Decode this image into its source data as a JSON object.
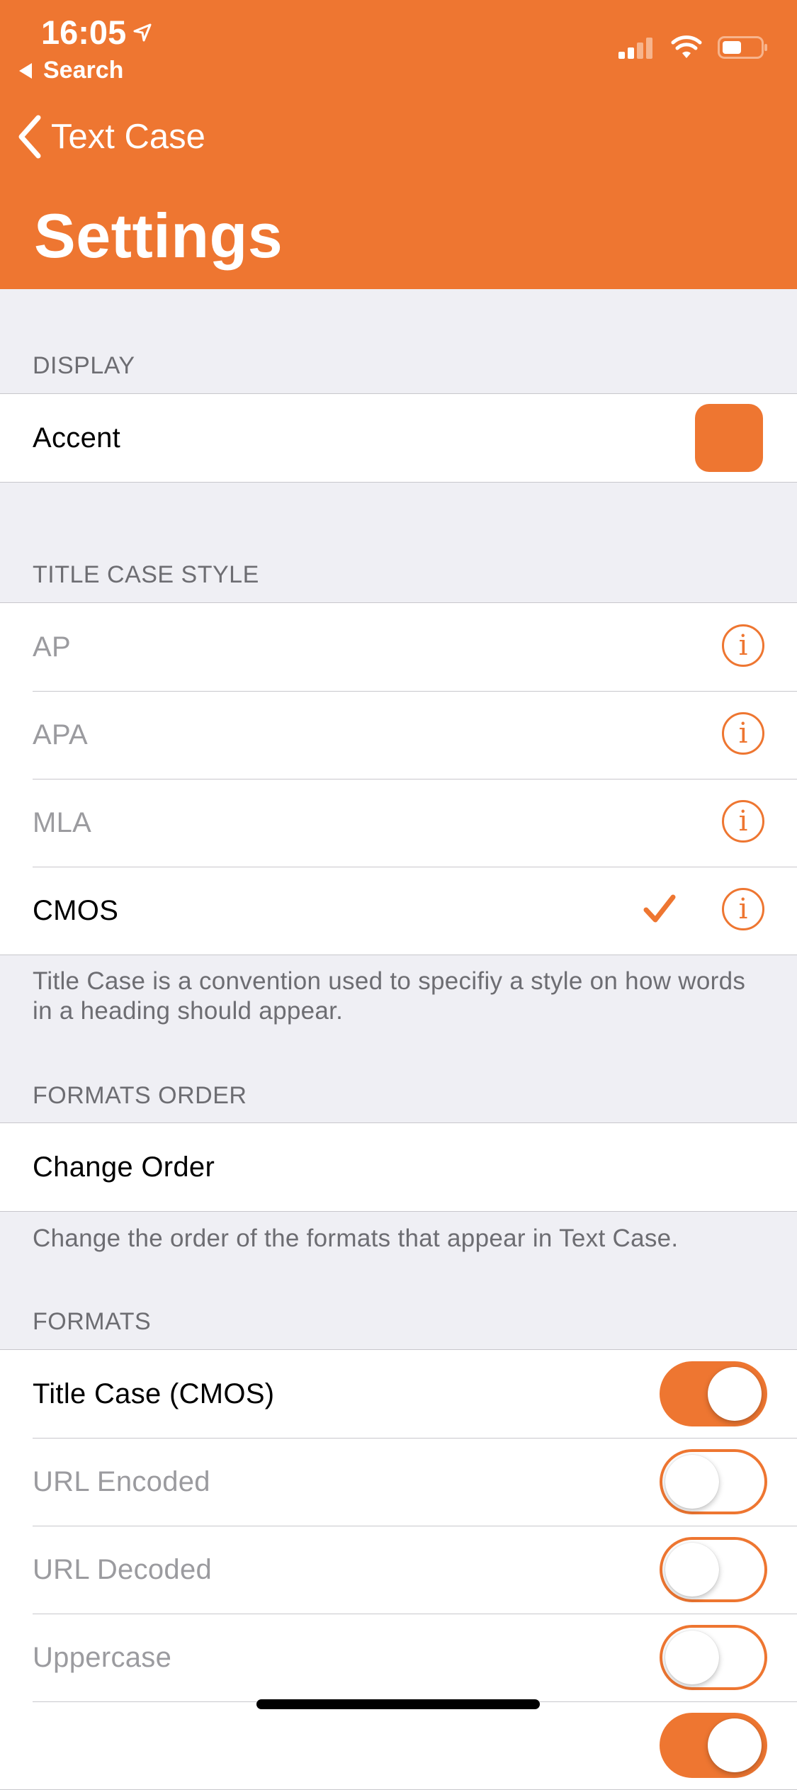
{
  "status_bar": {
    "time": "16:05",
    "back_app": "Search"
  },
  "nav": {
    "back_label": "Text Case",
    "title": "Settings"
  },
  "colors": {
    "accent": "#ee7631"
  },
  "display": {
    "header": "DISPLAY",
    "accent_label": "Accent"
  },
  "title_case_style": {
    "header": "TITLE CASE STYLE",
    "options": [
      {
        "label": "AP",
        "selected": false,
        "info_icon": "info-circle-icon"
      },
      {
        "label": "APA",
        "selected": false,
        "info_icon": "info-circle-icon"
      },
      {
        "label": "MLA",
        "selected": false,
        "info_icon": "info-circle-icon"
      },
      {
        "label": "CMOS",
        "selected": true,
        "info_icon": "info-circle-icon"
      }
    ],
    "footer": "Title Case is a convention used to specifiy a style on how words in a heading should appear."
  },
  "formats_order": {
    "header": "FORMATS ORDER",
    "change_label": "Change Order",
    "footer": "Change the order of the formats that appear in Text Case."
  },
  "formats": {
    "header": "FORMATS",
    "items": [
      {
        "label": "Title Case (CMOS)",
        "enabled": true
      },
      {
        "label": "URL Encoded",
        "enabled": false
      },
      {
        "label": "URL Decoded",
        "enabled": false
      },
      {
        "label": "Uppercase",
        "enabled": false
      }
    ]
  }
}
